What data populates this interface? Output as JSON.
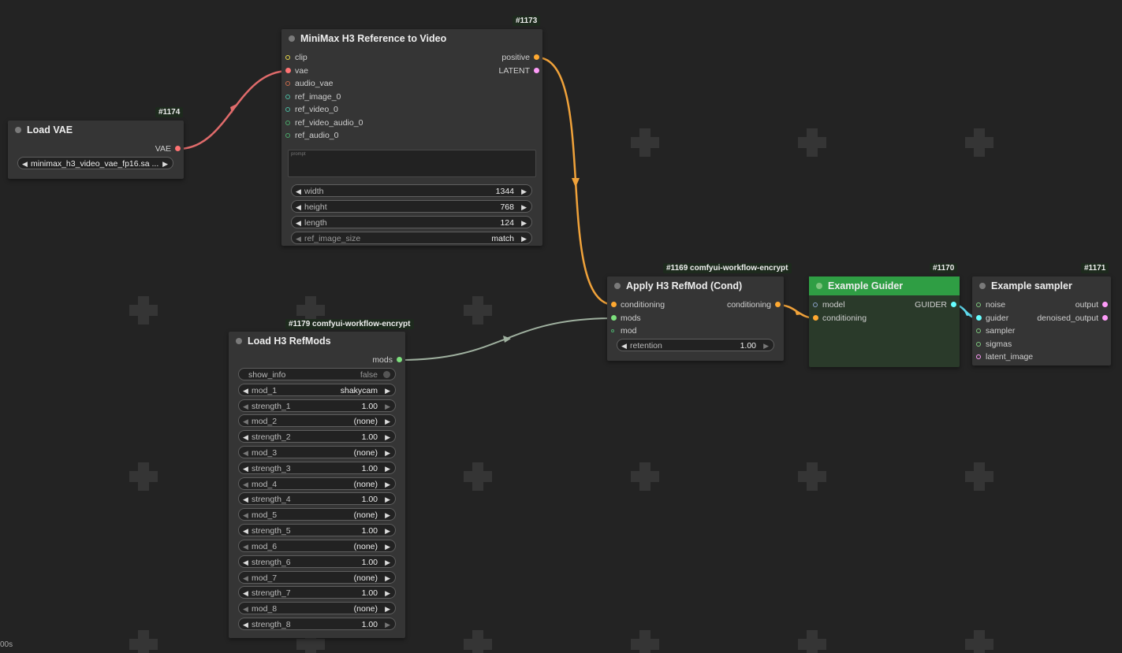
{
  "colors": {
    "canvas_bg": "#232323",
    "node_bg": "#353535",
    "guider_header": "#2f9e44",
    "guider_body": "#2a3a2a",
    "link_clip_vae": "#e06b6b",
    "link_conditioning": "#f0a23a",
    "link_mods": "#9fb09f",
    "link_guider": "#5ed8ec",
    "slot_clip": "#e8d84a",
    "slot_vae": "#ff7373",
    "slot_audio": "#c86a4a",
    "slot_image": "#4ab8a0",
    "slot_conditioning": "#ffa931",
    "slot_latent": "#ff9cf9",
    "slot_mods": "#7de07d",
    "slot_guider": "#66ffff",
    "slot_generic": "#7ec87e"
  },
  "nodes": {
    "load_vae": {
      "id": "#1174",
      "title": "Load VAE",
      "output": "VAE",
      "vae_name": "minimax_h3_video_vae_fp16.sa ..."
    },
    "ref_to_video": {
      "id": "#1173",
      "title": "MiniMax H3 Reference to Video",
      "inputs": [
        "clip",
        "vae",
        "audio_vae",
        "ref_image_0",
        "ref_video_0",
        "ref_video_audio_0",
        "ref_audio_0"
      ],
      "outputs": [
        "positive",
        "LATENT"
      ],
      "prompt_placeholder": "prompt",
      "widgets": [
        {
          "label": "width",
          "value": "1344"
        },
        {
          "label": "height",
          "value": "768"
        },
        {
          "label": "length",
          "value": "124"
        },
        {
          "label": "ref_image_size",
          "value": "match"
        }
      ]
    },
    "load_refmods": {
      "id": "#1179 comfyui-workflow-encrypt",
      "title": "Load H3 RefMods",
      "output": "mods",
      "show_info": {
        "label": "show_info",
        "value": "false"
      },
      "widgets": [
        {
          "label": "mod_1",
          "value": "shakycam"
        },
        {
          "label": "strength_1",
          "value": "1.00"
        },
        {
          "label": "mod_2",
          "value": "(none)"
        },
        {
          "label": "strength_2",
          "value": "1.00"
        },
        {
          "label": "mod_3",
          "value": "(none)"
        },
        {
          "label": "strength_3",
          "value": "1.00"
        },
        {
          "label": "mod_4",
          "value": "(none)"
        },
        {
          "label": "strength_4",
          "value": "1.00"
        },
        {
          "label": "mod_5",
          "value": "(none)"
        },
        {
          "label": "strength_5",
          "value": "1.00"
        },
        {
          "label": "mod_6",
          "value": "(none)"
        },
        {
          "label": "strength_6",
          "value": "1.00"
        },
        {
          "label": "mod_7",
          "value": "(none)"
        },
        {
          "label": "strength_7",
          "value": "1.00"
        },
        {
          "label": "mod_8",
          "value": "(none)"
        },
        {
          "label": "strength_8",
          "value": "1.00"
        }
      ]
    },
    "apply_refmod": {
      "id": "#1169 comfyui-workflow-encrypt",
      "title": "Apply H3 RefMod (Cond)",
      "inputs": [
        "conditioning",
        "mods",
        "mod"
      ],
      "output": "conditioning",
      "retention": {
        "label": "retention",
        "value": "1.00"
      }
    },
    "example_guider": {
      "id": "#1170",
      "title": "Example Guider",
      "inputs": [
        "model",
        "conditioning"
      ],
      "output": "GUIDER"
    },
    "example_sampler": {
      "id": "#1171",
      "title": "Example sampler",
      "inputs": [
        "noise",
        "guider",
        "sampler",
        "sigmas",
        "latent_image"
      ],
      "outputs": [
        "output",
        "denoised_output"
      ]
    }
  },
  "status": {
    "timer": "00s"
  }
}
